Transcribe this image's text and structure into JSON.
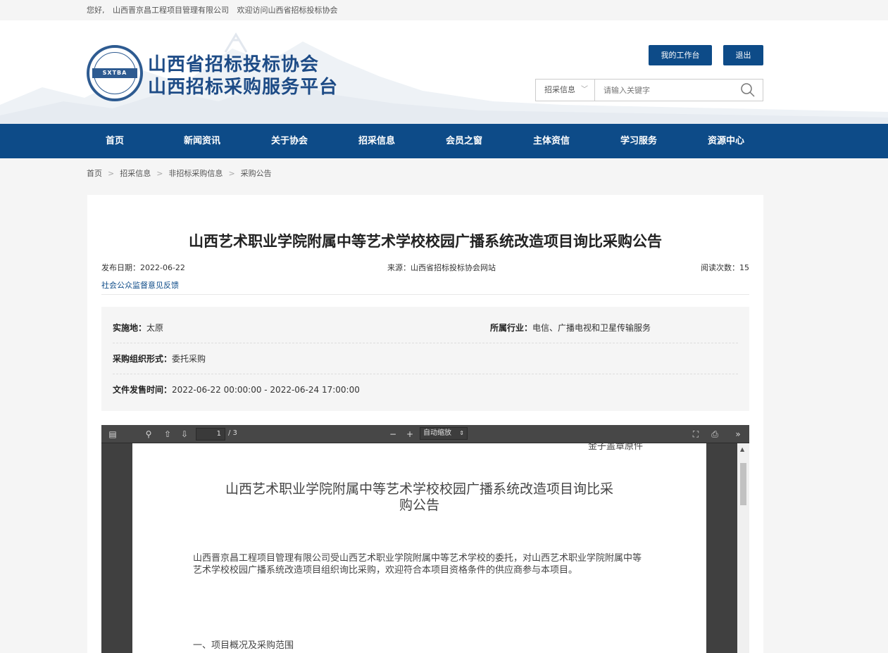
{
  "topbar": {
    "greeting": "您好,",
    "company": "山西晋京昌工程项目管理有限公司",
    "welcome": "欢迎访问山西省招标投标协会"
  },
  "header": {
    "logo_badge": "SXTBA",
    "title_line1": "山西省招标投标协会",
    "title_line2": "山西招标采购服务平台",
    "workbench_label": "我的工作台",
    "logout_label": "退出",
    "search_category": "招采信息",
    "search_placeholder": "请输入关键字"
  },
  "nav": {
    "items": [
      "首页",
      "新闻资讯",
      "关于协会",
      "招采信息",
      "会员之窗",
      "主体资信",
      "学习服务",
      "资源中心"
    ]
  },
  "breadcrumb": [
    "首页",
    "招采信息",
    "非招标采购信息",
    "采购公告"
  ],
  "article": {
    "title": "山西艺术职业学院附属中等艺术学校校园广播系统改造项目询比采购公告",
    "publish_date": "发布日期：2022-06-22",
    "source": "来源：山西省招标投标协会网站",
    "read_count": "阅读次数：15",
    "feedback_link": "社会公众监督意见反馈"
  },
  "info": {
    "location_label": "实施地：",
    "location_value": "太原",
    "industry_label": "所属行业：",
    "industry_value": "电信、广播电视和卫星传输服务",
    "org_form_label": "采购组织形式：",
    "org_form_value": "委托采购",
    "sale_time_label": "文件发售时间：",
    "sale_time_value": "2022-06-22 00:00:00 - 2022-06-24 17:00:00"
  },
  "pdf_viewer": {
    "current_page": "1",
    "page_count": "/ 3",
    "zoom_label": "自动缩放",
    "doc_cut_text": "金子盖章原件",
    "doc_title_line1": "山西艺术职业学院附属中等艺术学校校园广播系统改造项目询比采",
    "doc_title_line2": "购公告",
    "doc_paragraph": "山西晋京昌工程项目管理有限公司受山西艺术职业学院附属中等艺术学校的委托，对山西艺术职业学院附属中等艺术学校校园广播系统改造项目组织询比采购，欢迎符合本项目资格条件的供应商参与本项目。",
    "doc_section1": "一、项目概况及采购范围"
  },
  "colors": {
    "brand_blue": "#0d4b88",
    "logo_blue": "#1d4b86"
  }
}
